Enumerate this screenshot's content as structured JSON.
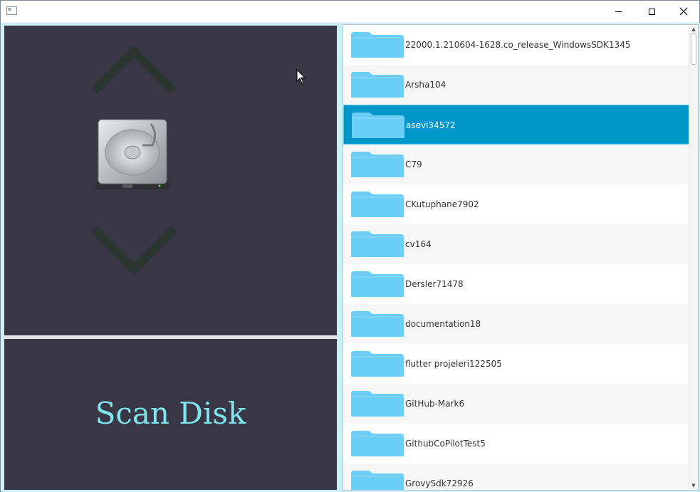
{
  "window": {
    "title": ""
  },
  "left": {
    "scan_button_label": "Scan Disk"
  },
  "folders": [
    {
      "name": "22000.1.210604-1628.co_release_WindowsSDK1345",
      "selected": false
    },
    {
      "name": "Arsha104",
      "selected": false
    },
    {
      "name": "asevi34572",
      "selected": true
    },
    {
      "name": "C79",
      "selected": false
    },
    {
      "name": "CKutuphane7902",
      "selected": false
    },
    {
      "name": "cv164",
      "selected": false
    },
    {
      "name": "Dersler71478",
      "selected": false
    },
    {
      "name": "documentation18",
      "selected": false
    },
    {
      "name": "flutter projeleri122505",
      "selected": false
    },
    {
      "name": "GitHub-Mark6",
      "selected": false
    },
    {
      "name": "GithubCoPilotTest5",
      "selected": false
    },
    {
      "name": "GrovySdk72926",
      "selected": false
    }
  ],
  "colors": {
    "panel_bg": "#393646",
    "chevron": "#2b3530",
    "scan_text": "#7fe6ee",
    "selected_row": "#0096c9",
    "folder_icon": "#6ccdf6"
  },
  "icons": {
    "up": "chevron-up-icon",
    "down": "chevron-down-icon",
    "disk": "hard-disk-icon",
    "folder": "folder-icon"
  }
}
